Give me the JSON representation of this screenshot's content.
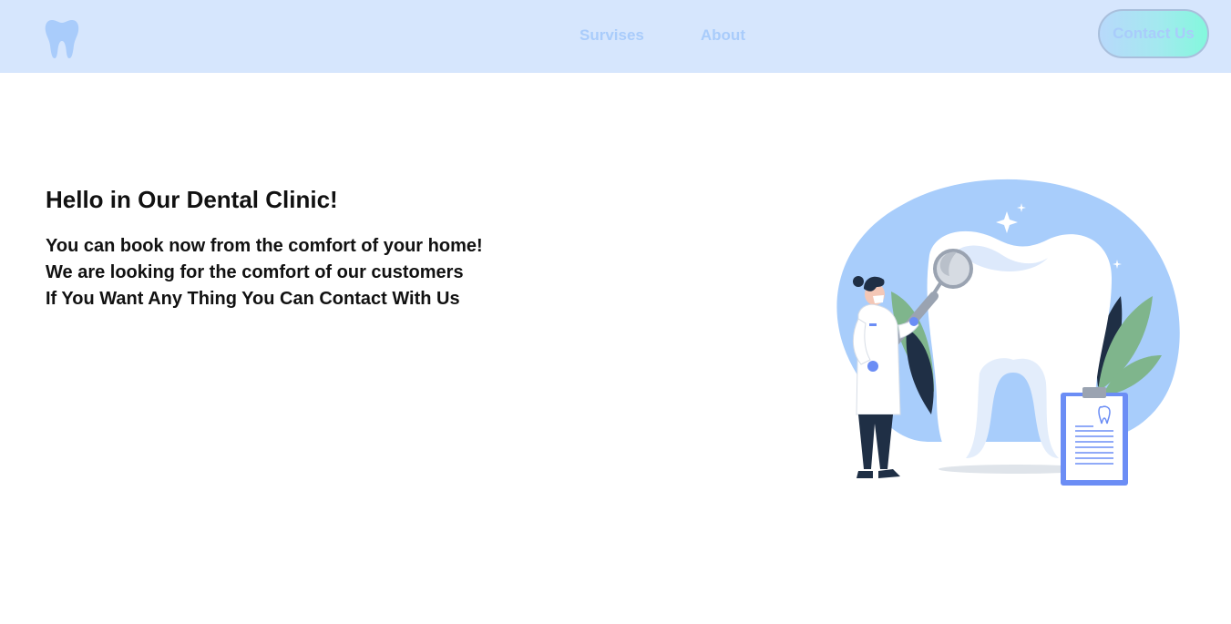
{
  "nav": {
    "links": [
      "Survises",
      "About"
    ],
    "contact_label": "Contact Us"
  },
  "hero": {
    "title": "Hello in Our Dental Clinic!",
    "lines": [
      "You can book now from the comfort of your home!",
      "We are looking for the comfort of our customers",
      "If You Want Any Thing You Can Contact With Us"
    ]
  },
  "icons": {
    "logo": "tooth-icon",
    "illustration": "dentist-with-mirror-illustration"
  },
  "colors": {
    "navbar_bg": "#d6e6fd",
    "nav_text": "#a9ccfb",
    "button_gradient_start": "#b8d9fb",
    "button_gradient_end": "#83f8dc",
    "hero_text": "#111111",
    "blob": "#a8cdfb"
  }
}
